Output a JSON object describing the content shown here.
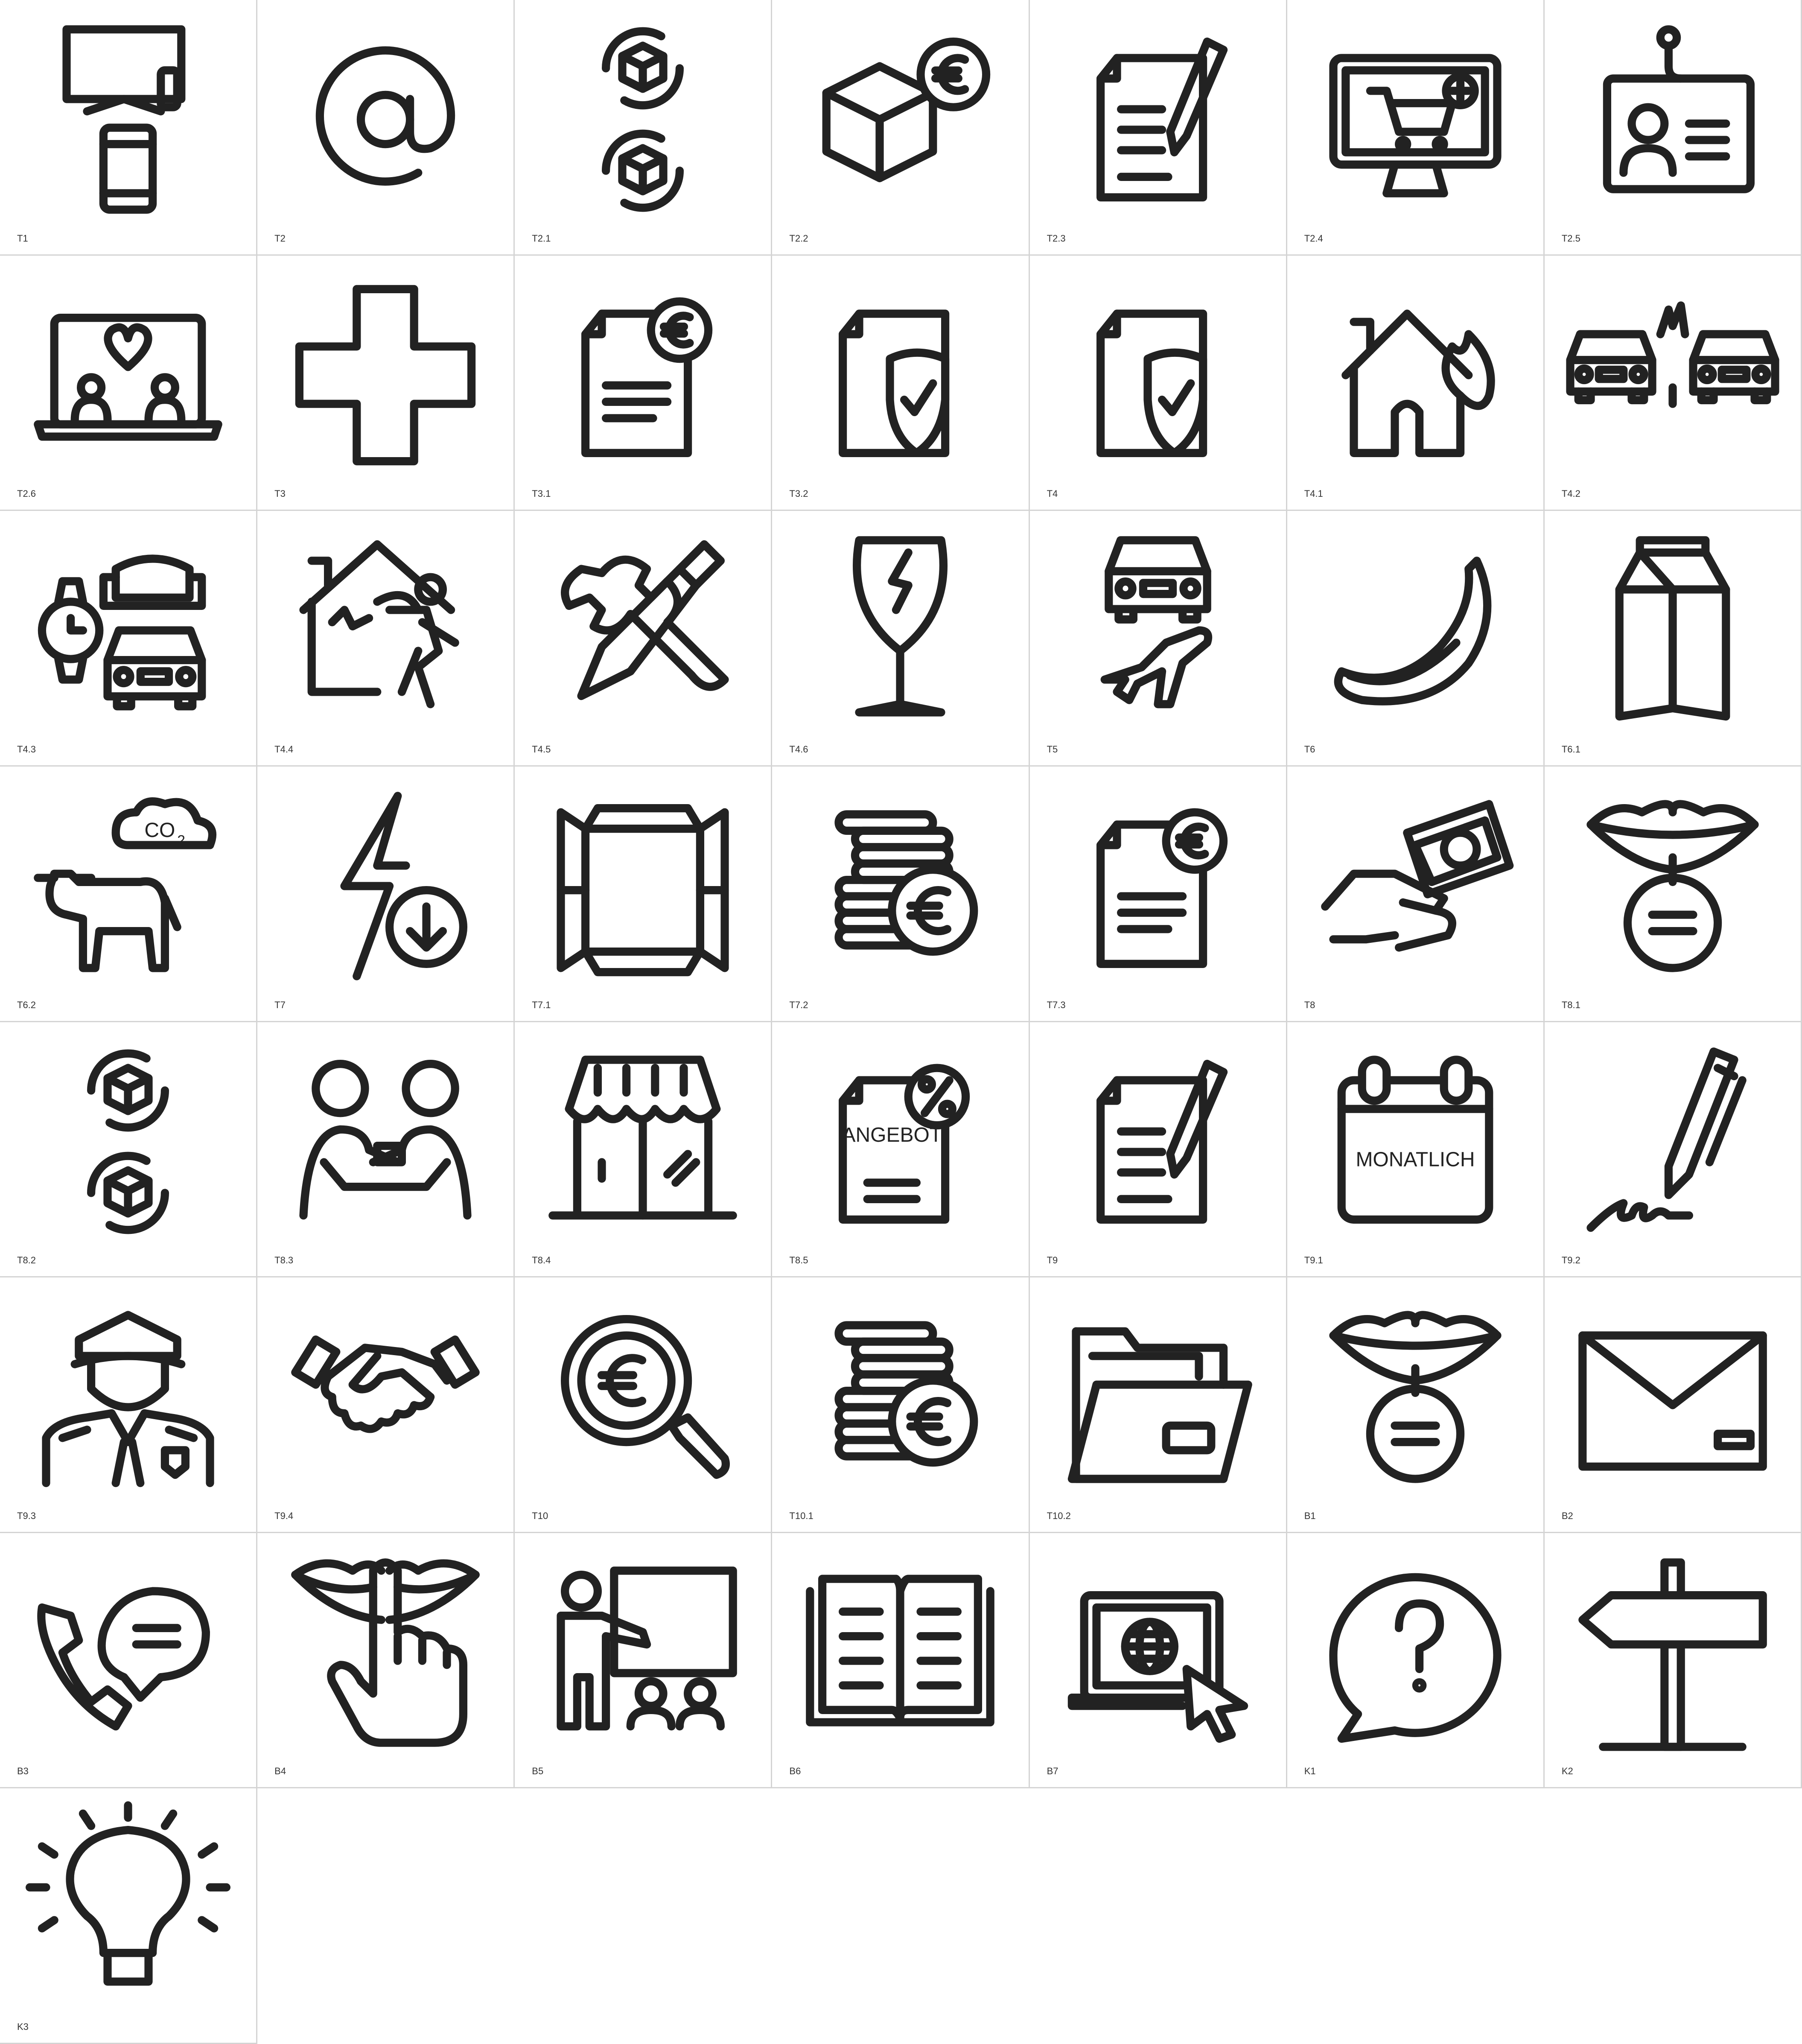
{
  "icons": [
    {
      "code": "T1",
      "icon": "tv-and-phone-icon"
    },
    {
      "code": "T2",
      "icon": "at-sign-icon"
    },
    {
      "code": "T2.1",
      "icon": "package-cycle-icon"
    },
    {
      "code": "T2.2",
      "icon": "package-euro-icon"
    },
    {
      "code": "T2.3",
      "icon": "document-pen-icon"
    },
    {
      "code": "T2.4",
      "icon": "monitor-cart-icon"
    },
    {
      "code": "T2.5",
      "icon": "id-badge-icon"
    },
    {
      "code": "T2.6",
      "icon": "laptop-heart-icon"
    },
    {
      "code": "T3",
      "icon": "medical-cross-icon"
    },
    {
      "code": "T3.1",
      "icon": "document-euro-icon"
    },
    {
      "code": "T3.2",
      "icon": "document-shield-icon"
    },
    {
      "code": "T4",
      "icon": "document-shield-icon"
    },
    {
      "code": "T4.1",
      "icon": "house-fire-icon"
    },
    {
      "code": "T4.2",
      "icon": "car-crash-icon"
    },
    {
      "code": "T4.3",
      "icon": "watch-sofa-car-icon"
    },
    {
      "code": "T4.4",
      "icon": "burglar-house-icon"
    },
    {
      "code": "T4.5",
      "icon": "tools-icon"
    },
    {
      "code": "T4.6",
      "icon": "broken-glass-icon"
    },
    {
      "code": "T5",
      "icon": "car-plane-icon"
    },
    {
      "code": "T6",
      "icon": "banana-icon"
    },
    {
      "code": "T6.1",
      "icon": "milk-carton-icon"
    },
    {
      "code": "T6.2",
      "icon": "cow-co2-icon",
      "label": "CO",
      "subscript": "2"
    },
    {
      "code": "T7",
      "icon": "lightning-download-icon"
    },
    {
      "code": "T7.1",
      "icon": "open-box-icon"
    },
    {
      "code": "T7.2",
      "icon": "coins-euro-icon"
    },
    {
      "code": "T7.3",
      "icon": "document-euro-icon"
    },
    {
      "code": "T8",
      "icon": "hand-money-icon"
    },
    {
      "code": "T8.1",
      "icon": "lips-speech-icon"
    },
    {
      "code": "T8.2",
      "icon": "package-cycle-icon"
    },
    {
      "code": "T8.3",
      "icon": "people-exchange-icon"
    },
    {
      "code": "T8.4",
      "icon": "storefront-icon"
    },
    {
      "code": "T8.5",
      "icon": "offer-document-icon",
      "label": "ANGEBOT"
    },
    {
      "code": "T9",
      "icon": "document-pen-icon"
    },
    {
      "code": "T9.1",
      "icon": "calendar-monthly-icon",
      "label": "MONATLICH"
    },
    {
      "code": "T9.2",
      "icon": "pen-signature-icon"
    },
    {
      "code": "T9.3",
      "icon": "police-officer-icon"
    },
    {
      "code": "T9.4",
      "icon": "handshake-icon"
    },
    {
      "code": "T10",
      "icon": "magnifier-euro-icon"
    },
    {
      "code": "T10.1",
      "icon": "coins-euro-icon"
    },
    {
      "code": "T10.2",
      "icon": "folder-icon"
    },
    {
      "code": "B1",
      "icon": "lips-speech-icon"
    },
    {
      "code": "B2",
      "icon": "envelope-icon"
    },
    {
      "code": "B3",
      "icon": "phone-chat-icon"
    },
    {
      "code": "B4",
      "icon": "lips-finger-icon"
    },
    {
      "code": "B5",
      "icon": "presentation-icon"
    },
    {
      "code": "B6",
      "icon": "open-book-icon"
    },
    {
      "code": "B7",
      "icon": "laptop-globe-icon"
    },
    {
      "code": "K1",
      "icon": "question-bubble-icon"
    },
    {
      "code": "K2",
      "icon": "signpost-icon"
    },
    {
      "code": "K3",
      "icon": "light-bulb-icon"
    }
  ]
}
